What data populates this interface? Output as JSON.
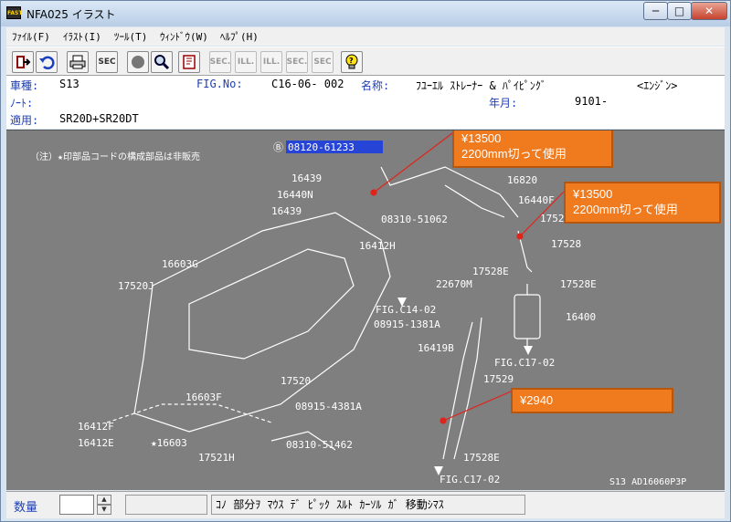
{
  "window": {
    "app_icon": "FAST",
    "title": "NFA025 イラスト",
    "min_label": "─",
    "max_label": "□",
    "close_label": "✕"
  },
  "menu": [
    "ﾌｧｲﾙ(F)",
    "ｲﾗｽﾄ(I)",
    "ﾂｰﾙ(T)",
    "ｳｨﾝﾄﾞｳ(W)",
    "ﾍﾙﾌﾟ(H)"
  ],
  "toolbar": {
    "sec_label": "SEC",
    "disabled_buttons": [
      "SEC.",
      "ILL.",
      "ILL.",
      "SEC.",
      "SEC"
    ]
  },
  "info": {
    "model_label": "車種:",
    "model_value": "S13",
    "fig_label": "FIG.No:",
    "fig_value": "C16-06- 002",
    "name_label": "名称:",
    "name_value": "ﾌﾕｰｴﾙ ｽﾄﾚｰﾅｰ & ﾊﾟｲﾋﾟﾝｸﾞ",
    "category_value": "<ｴﾝｼﾞﾝ>",
    "note_label": "ﾉｰﾄ:",
    "year_label": "年月:",
    "year_value": "9101-",
    "apply_label": "適用:",
    "apply_value": "SR20D+SR20DT"
  },
  "diagram": {
    "note": "（注）★印部品コードの構成部品は非販売",
    "selected_part": "08120-61233",
    "footer_code": "S13  AD16060P3P",
    "part_labels": [
      "16439",
      "16440N",
      "16439",
      "08310-51062",
      "16820",
      "16440F",
      "1752",
      "17528",
      "16412H",
      "16603G",
      "22670M",
      "17528E",
      "17528E",
      "17520J",
      "FIG.C14-02",
      "08915-1381A",
      "16400",
      "16419B",
      "FIG.C17-02",
      "17529",
      "17520",
      "16603F",
      "08915-4381A",
      "16412F",
      "16412E",
      "★16603",
      "17521H",
      "08310-51462",
      "17528E",
      "FIG.C17-02"
    ]
  },
  "callouts": [
    {
      "line1": "¥13500",
      "line2": "2200mm切って使用"
    },
    {
      "line1": "¥13500",
      "line2": "2200mm切って使用"
    },
    {
      "line1": "¥2940"
    }
  ],
  "status": {
    "quantity_label": "数量",
    "spin_up": "▲",
    "spin_down": "▼",
    "message": "ｺﾉ 部分ｦ ﾏｳｽ ﾃﾞ ﾋﾟｯｸ ｽﾙﾄ ｶｰｿﾙ ｶﾞ 移動ｼﾏｽ"
  }
}
